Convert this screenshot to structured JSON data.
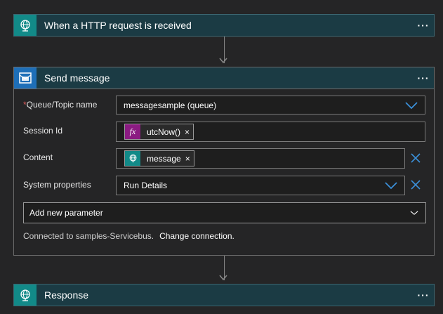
{
  "trigger": {
    "title": "When a HTTP request is received",
    "menu": "···"
  },
  "send_message": {
    "title": "Send message",
    "menu": "···",
    "fields": {
      "queue_topic": {
        "label": "Queue/Topic name",
        "required_mark": "*",
        "value": "messagesample (queue)"
      },
      "session_id": {
        "label": "Session Id",
        "token": "utcNow()",
        "token_glyph": "fx",
        "token_remove": "×"
      },
      "content": {
        "label": "Content",
        "token": "message",
        "token_remove": "×"
      },
      "system_properties": {
        "label": "System properties",
        "value": "Run Details"
      }
    },
    "add_parameter": "Add new parameter",
    "connection_text": "Connected to samples-Servicebus.",
    "change_connection": "Change connection."
  },
  "response": {
    "title": "Response",
    "menu": "···"
  },
  "colors": {
    "canvas": "#252526",
    "card_header": "#1b3b44",
    "http_icon": "#128a88",
    "servicebus_icon": "#1e6fb8",
    "fx_token": "#8b1b82",
    "accent_blue": "#3b8fd8"
  },
  "icons": {
    "trigger": "globe-icon",
    "send": "service-bus-icon",
    "response": "globe-icon",
    "dropdown": "chevron-down-icon",
    "remove": "close-icon"
  }
}
